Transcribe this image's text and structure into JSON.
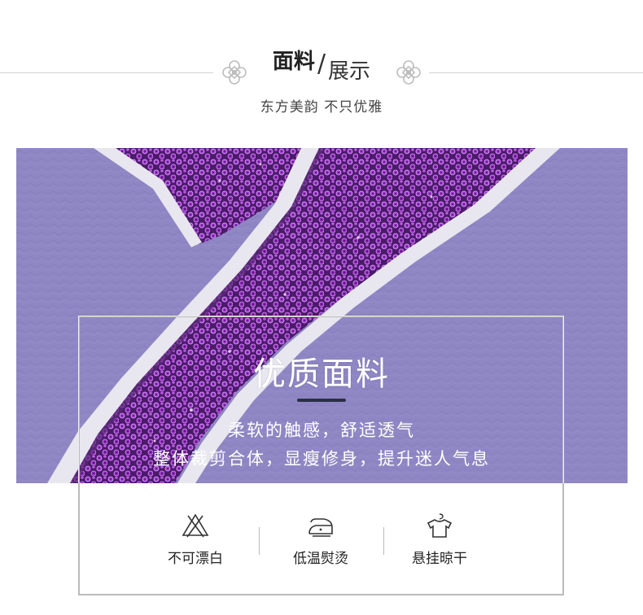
{
  "header": {
    "title_bold": "面料",
    "title_slash": "/",
    "title_light": "展示",
    "subtitle": "东方美韵 不只优雅"
  },
  "overlay": {
    "title": "优质面料",
    "line1": "柔软的触感，舒适透气",
    "line2": "整体裁剪合体，显瘦修身，提升迷人气息"
  },
  "care": [
    {
      "icon": "no-bleach-icon",
      "label": "不可漂白"
    },
    {
      "icon": "low-iron-icon",
      "label": "低温熨烫"
    },
    {
      "icon": "hang-dry-icon",
      "label": "悬挂晾干"
    }
  ],
  "colors": {
    "fabric_purple": "#8f86c4",
    "sequin_purple": "#7b1fa2",
    "piping": "#e8e6ee",
    "bar": "#2a2f45"
  }
}
